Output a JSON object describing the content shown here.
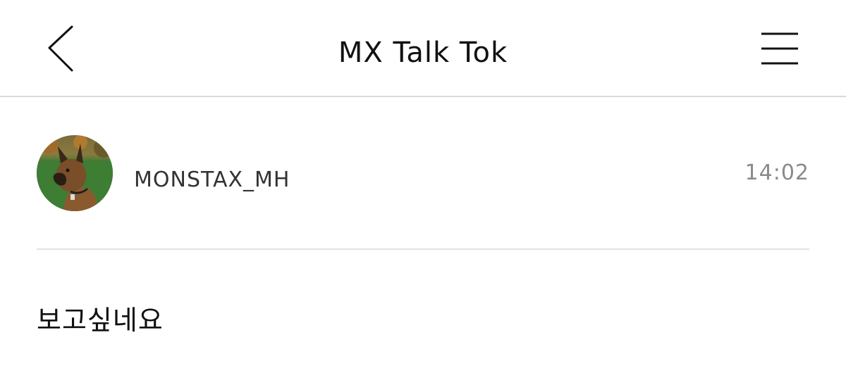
{
  "header": {
    "title": "MX Talk Tok",
    "back_icon": "chevron-left-icon",
    "menu_icon": "hamburger-menu-icon"
  },
  "post": {
    "username": "MONSTAX_MH",
    "time": "14:02",
    "avatar_description": "dog-photo-avatar",
    "message": "보고싶네요"
  },
  "colors": {
    "background": "#ffffff",
    "text": "#111111",
    "muted": "#8a8a8a",
    "divider": "#e2e2e2"
  }
}
